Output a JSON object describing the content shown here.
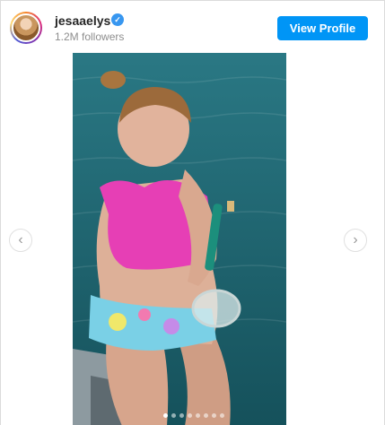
{
  "header": {
    "username": "jesaaelys",
    "followers": "1.2M followers",
    "view_profile_label": "View Profile"
  },
  "icons": {
    "verified": "verified-badge-icon",
    "prev": "chevron-left-icon",
    "next": "chevron-right-icon",
    "verified_glyph": "✓",
    "prev_glyph": "‹",
    "next_glyph": "›"
  },
  "carousel": {
    "total_slides": 8,
    "active_index": 0
  },
  "colors": {
    "accent": "#0095f6",
    "verified": "#3897f0",
    "water": "#1e6a78",
    "swimsuit_top": "#e63fb5"
  }
}
